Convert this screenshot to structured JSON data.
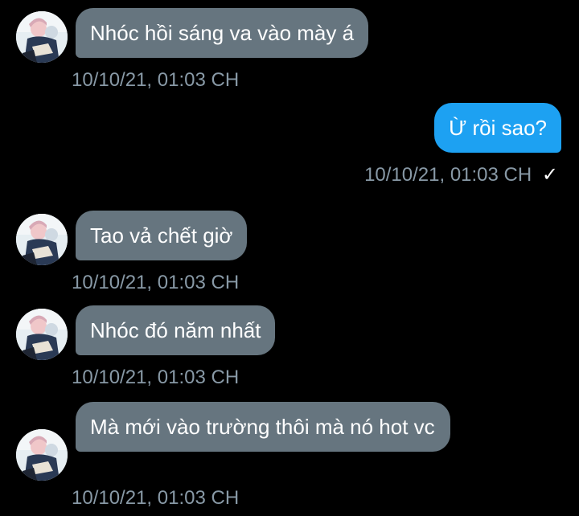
{
  "messages": [
    {
      "direction": "in",
      "text": "Nhóc hồi sáng va vào mày á",
      "timestamp": "10/10/21, 01:03 CH"
    },
    {
      "direction": "out",
      "text": "Ừ rồi sao?",
      "timestamp": "10/10/21, 01:03 CH",
      "status_icon": "✓"
    },
    {
      "direction": "in",
      "text": "Tao vả chết giờ",
      "timestamp": "10/10/21, 01:03 CH"
    },
    {
      "direction": "in",
      "text": "Nhóc đó năm nhất",
      "timestamp": "10/10/21, 01:03 CH"
    },
    {
      "direction": "in",
      "text": "Mà mới vào trường thôi mà nó hot vc",
      "timestamp": "10/10/21, 01:03 CH"
    }
  ],
  "colors": {
    "background": "#000000",
    "incoming_bubble": "#66757f",
    "outgoing_bubble": "#1da1f2",
    "timestamp_text": "#8899a6"
  },
  "icons": {
    "avatar": "profile-avatar",
    "read_receipt": "checkmark-icon"
  }
}
